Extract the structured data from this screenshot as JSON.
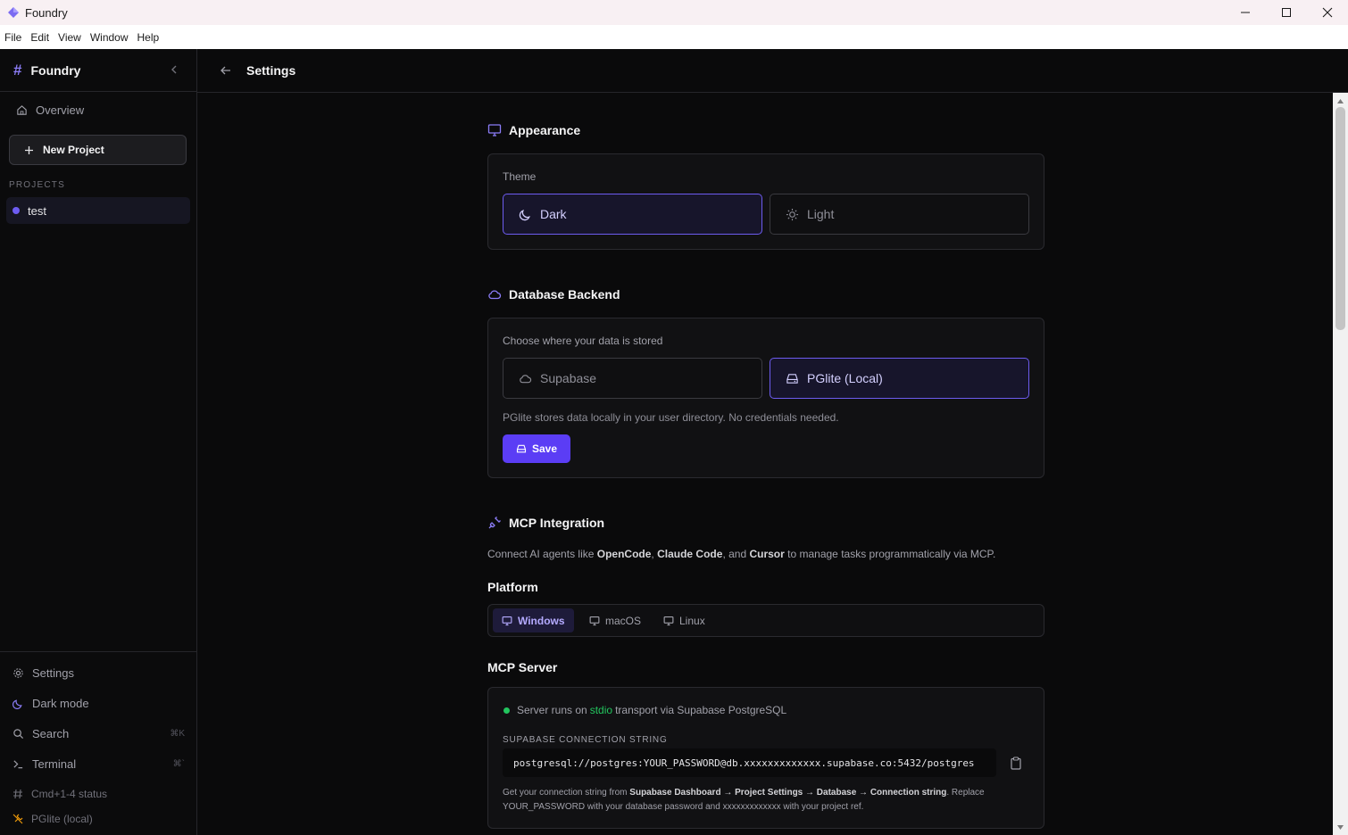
{
  "window": {
    "title": "Foundry"
  },
  "menu": [
    "File",
    "Edit",
    "View",
    "Window",
    "Help"
  ],
  "sidebar": {
    "brand": "Foundry",
    "overview": "Overview",
    "new_project": "New Project",
    "projects_heading": "PROJECTS",
    "projects": [
      {
        "name": "test"
      }
    ],
    "bottom": {
      "settings": "Settings",
      "dark_mode": "Dark mode",
      "search": "Search",
      "search_kbd": "⌘K",
      "terminal": "Terminal",
      "terminal_kbd": "⌘`",
      "status_hint": "Cmd+1-4 status",
      "backend": "PGlite (local)"
    }
  },
  "header": {
    "title": "Settings"
  },
  "appearance": {
    "title": "Appearance",
    "theme_label": "Theme",
    "dark": "Dark",
    "light": "Light",
    "selected": "Dark"
  },
  "database": {
    "title": "Database Backend",
    "label": "Choose where your data is stored",
    "supabase": "Supabase",
    "pglite": "PGlite (Local)",
    "selected": "PGlite (Local)",
    "note": "PGlite stores data locally in your user directory. No credentials needed.",
    "save": "Save"
  },
  "mcp": {
    "title": "MCP Integration",
    "desc_prefix": "Connect AI agents like ",
    "agent1": "OpenCode",
    "sep1": ", ",
    "agent2": "Claude Code",
    "sep2": ", and ",
    "agent3": "Cursor",
    "desc_suffix": " to manage tasks programmatically via MCP.",
    "platform_heading": "Platform",
    "platforms": [
      "Windows",
      "macOS",
      "Linux"
    ],
    "selected_platform": "Windows",
    "server_heading": "MCP Server",
    "status_prefix": "Server runs on",
    "status_transport": "stdio",
    "status_suffix": "transport via Supabase PostgreSQL",
    "conn_label": "SUPABASE CONNECTION STRING",
    "conn_string": "postgresql://postgres:YOUR_PASSWORD@db.xxxxxxxxxxxxx.supabase.co:5432/postgres",
    "help_1": "Get your connection string from ",
    "help_b1": "Supabase Dashboard → Project Settings → Database → Connection string",
    "help_2": ". Replace ",
    "help_3": "YOUR_PASSWORD with your database password and xxxxxxxxxxxxx with your project ref."
  },
  "colors": {
    "accent": "#5b3df5",
    "accent_border": "#6d5cf0",
    "status_green": "#22c55e",
    "background": "#0a0a0b"
  }
}
